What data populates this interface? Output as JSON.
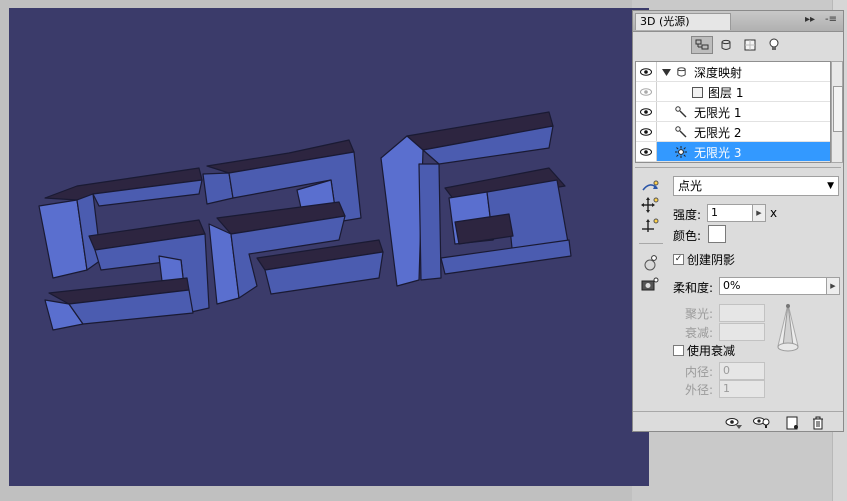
{
  "panel": {
    "tab_title": "3D (光源)",
    "header_buttons": [
      "▸▸",
      "-≡"
    ]
  },
  "toolbar": {
    "buttons": [
      "scene-filter-icon",
      "mesh-filter-icon",
      "material-filter-icon",
      "light-filter-icon"
    ]
  },
  "layers": [
    {
      "label": "深度映射",
      "icon": "mesh-icon",
      "expanded": true,
      "indent": 0
    },
    {
      "label": "图层 1",
      "icon": "layer-icon",
      "indent": 1
    },
    {
      "label": "无限光 1",
      "icon": "infinite-light-icon",
      "indent": 0
    },
    {
      "label": "无限光 2",
      "icon": "infinite-light-icon",
      "indent": 0
    },
    {
      "label": "无限光 3",
      "icon": "point-light-icon",
      "indent": 0,
      "selected": true
    }
  ],
  "properties": {
    "light_type": "点光",
    "intensity_label": "强度:",
    "intensity_value": "1",
    "intensity_suffix": "x",
    "color_label": "颜色:",
    "color_value": "#ffffff",
    "cast_shadow_label": "创建阴影",
    "cast_shadow_checked": true,
    "softness_label": "柔和度:",
    "softness_value": "0%",
    "hotspot_label": "聚光:",
    "falloff_label": "衰减:",
    "use_attenuation_label": "使用衰减",
    "use_attenuation_checked": false,
    "inner_label": "内径:",
    "inner_value": "0",
    "outer_label": "外径:",
    "outer_value": "1"
  },
  "canvas": {
    "background": "#3b3b6a",
    "text_3d": "526"
  },
  "footer": {
    "buttons": [
      "toggle-lights-icon",
      "place-light-icon",
      "new-light-icon",
      "delete-light-icon"
    ]
  }
}
